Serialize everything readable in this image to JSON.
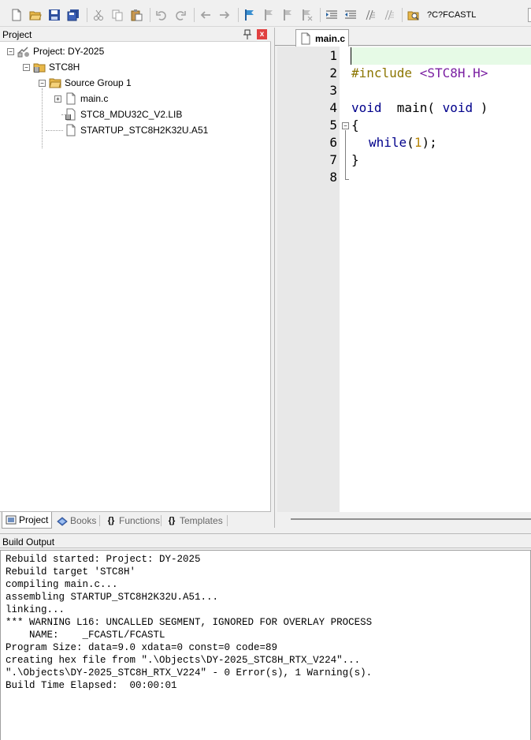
{
  "toolbar": {
    "buttons": [
      "new-file-icon",
      "open-folder-icon",
      "save-icon",
      "save-all-icon",
      "cut-icon",
      "copy-icon",
      "paste-icon",
      "undo-icon",
      "redo-icon",
      "nav-back-icon",
      "nav-forward-icon",
      "bookmark-icon",
      "bookmark-prev-icon",
      "bookmark-next-icon",
      "bookmark-clear-icon",
      "indent-icon",
      "unindent-icon",
      "comment-icon",
      "uncomment-icon",
      "find-in-files-icon"
    ],
    "find_text": "?C?FCASTL"
  },
  "project_pane": {
    "title": "Project",
    "close_label": "x",
    "tree": {
      "project": "Project: DY-2025",
      "target": "STC8H",
      "group": "Source Group 1",
      "files": [
        "main.c",
        "STC8_MDU32C_V2.LIB",
        "STARTUP_STC8H2K32U.A51"
      ]
    },
    "tabs": [
      {
        "label": "Project",
        "icon": "project-tab-icon",
        "active": true
      },
      {
        "label": "Books",
        "icon": "books-icon",
        "active": false
      },
      {
        "label": "Functions",
        "icon": "functions-icon",
        "active": false
      },
      {
        "label": "Templates",
        "icon": "templates-icon",
        "active": false
      }
    ]
  },
  "editor": {
    "tab_label": "main.c",
    "line_numbers": [
      "1",
      "2",
      "3",
      "4",
      "5",
      "6",
      "7",
      "8"
    ],
    "code": {
      "l2_pp": "#include",
      "l2_inc": "<STC8H.H>",
      "l4_void1": "void",
      "l4_main": "  main( ",
      "l4_void2": "void",
      "l4_close": " )",
      "l5": "{",
      "l6_kw": "while",
      "l6_open": "(",
      "l6_num": "1",
      "l6_close": ");",
      "l7": "}"
    },
    "fold_marker": "−"
  },
  "build_output": {
    "title": "Build Output",
    "lines": [
      "Rebuild started: Project: DY-2025",
      "Rebuild target 'STC8H'",
      "compiling main.c...",
      "assembling STARTUP_STC8H2K32U.A51...",
      "linking...",
      "*** WARNING L16: UNCALLED SEGMENT, IGNORED FOR OVERLAY PROCESS",
      "    NAME:    _FCASTL/FCASTL",
      "Program Size: data=9.0 xdata=0 const=0 code=89",
      "creating hex file from \".\\Objects\\DY-2025_STC8H_RTX_V224\"...",
      "\".\\Objects\\DY-2025_STC8H_RTX_V224\" - 0 Error(s), 1 Warning(s).",
      "Build Time Elapsed:  00:00:01"
    ]
  },
  "colors": {
    "keyword": "#00008b",
    "preprocessor": "#8b7500",
    "include": "#7a1fa2",
    "number": "#b8860b",
    "current_line": "#e6fae6"
  }
}
